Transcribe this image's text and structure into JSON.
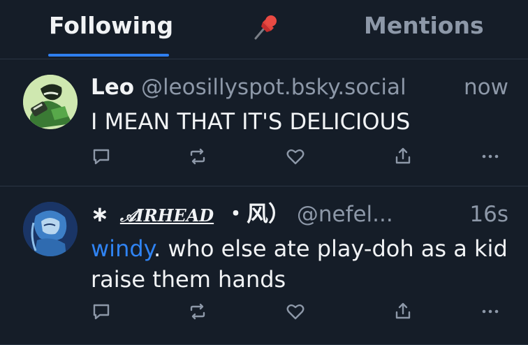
{
  "tabs": {
    "following": "Following",
    "pin_icon": "pin-icon",
    "mentions": "Mentions"
  },
  "posts": [
    {
      "display_name": "Leo",
      "handle": "@leosillyspot.bsky.social",
      "time": "now",
      "text": "I MEAN THAT IT'S DELICIOUS"
    },
    {
      "display_name_prefix": "∗",
      "display_name_art": "𝒜IRHEAD",
      "display_name_suffix": "・风）",
      "handle": "@nefel...",
      "time": "16s",
      "mention": "windy",
      "text": ". who else ate play-doh as a kid raise them hands"
    }
  ],
  "actions": {
    "reply_icon": "reply-icon",
    "repost_icon": "repost-icon",
    "like_icon": "heart-icon",
    "share_icon": "share-icon",
    "more_icon": "more-icon"
  },
  "colors": {
    "background": "#151d28",
    "accent": "#2f7ff0",
    "muted": "#8d98a8"
  }
}
